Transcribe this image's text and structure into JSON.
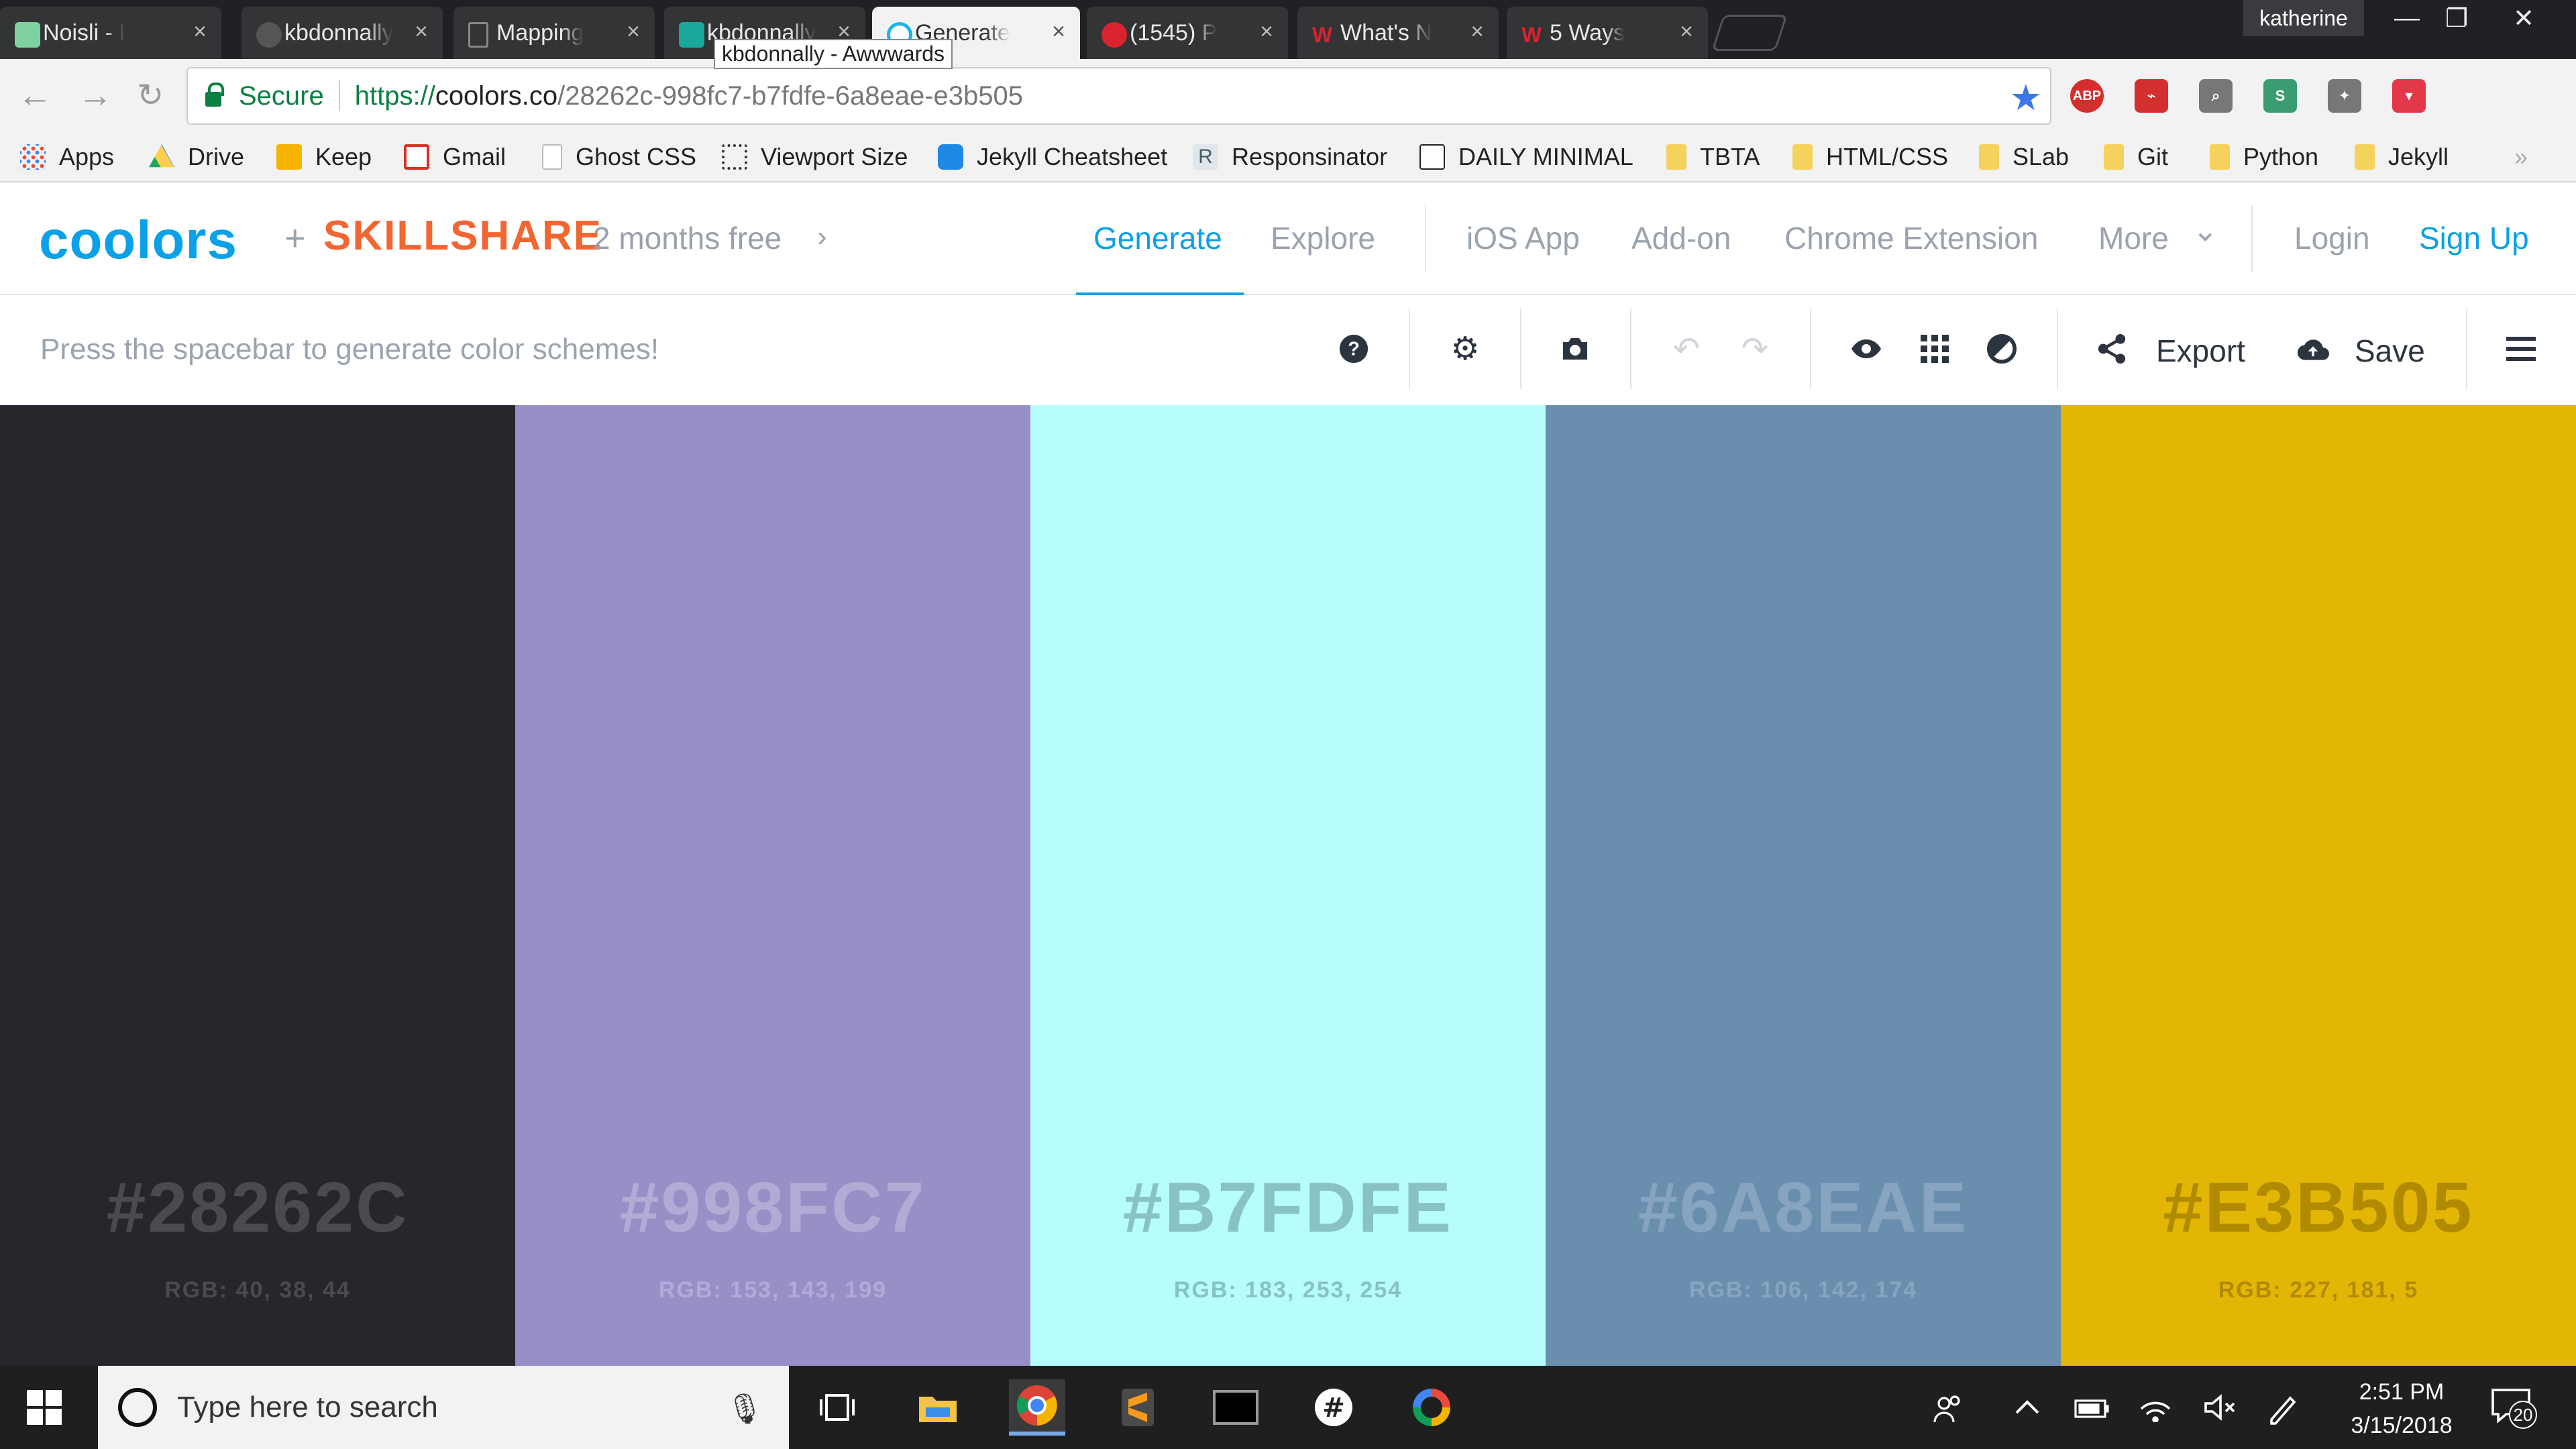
{
  "browser": {
    "tabs": [
      {
        "title": "Noisli - I",
        "favicon_color": "#7fd1a0"
      },
      {
        "title": "kbdonnally",
        "favicon_color": "#555555"
      },
      {
        "title": "Mapping",
        "favicon_color": "#777777"
      },
      {
        "title": "kbdonnally",
        "favicon_color": "#1aa89b"
      },
      {
        "title": "Generate",
        "favicon_color": "#1ab3ea",
        "active": true
      },
      {
        "title": "(1545) P",
        "favicon_color": "#d9232e"
      },
      {
        "title": "What's N",
        "favicon_color": "#d9232e"
      },
      {
        "title": "5 Ways",
        "favicon_color": "#d9232e"
      }
    ],
    "tab_close": "×",
    "tooltip": "kbdonnally - Awwwards",
    "profile": "katherine",
    "window_controls": {
      "minimize": "—",
      "restore": "❐",
      "close": "✕"
    },
    "address": {
      "secure_label": "Secure",
      "url_protocol": "https://",
      "url_host": "coolors.co",
      "url_path": "/28262c-998fc7-b7fdfe-6a8eae-e3b505"
    },
    "extensions": [
      {
        "name": "abp",
        "label": "ABP",
        "color": "#d32f2f"
      },
      {
        "name": "pdf",
        "label": "⌁",
        "color": "#d32f2f"
      },
      {
        "name": "inspect",
        "label": "⌕",
        "color": "#777777"
      },
      {
        "name": "s-ext",
        "label": "S",
        "color": "#3a9d72"
      },
      {
        "name": "bulb",
        "label": "✦",
        "color": "#777777"
      },
      {
        "name": "pocket",
        "label": "▾",
        "color": "#e2384a"
      }
    ],
    "bookmarks": [
      {
        "label": "Apps",
        "icon": "apps-grid-icon",
        "color": "#e84b3c"
      },
      {
        "label": "Drive",
        "icon": "drive-icon",
        "color": "#1fa463"
      },
      {
        "label": "Keep",
        "icon": "keep-icon",
        "color": "#f6b400"
      },
      {
        "label": "Gmail",
        "icon": "gmail-icon",
        "color": "#d93025"
      },
      {
        "label": "Ghost CSS",
        "icon": "page-icon",
        "color": "#dddddd"
      },
      {
        "label": "Viewport Size",
        "icon": "viewport-icon",
        "color": "#333333"
      },
      {
        "label": "Jekyll Cheatsheet",
        "icon": "eye-icon",
        "color": "#1e88e5"
      },
      {
        "label": "Responsinator",
        "icon": "r-icon",
        "color": "#607d8b"
      },
      {
        "label": "DAILY MINIMAL",
        "icon": "triangle-icon",
        "color": "#222222"
      },
      {
        "label": "TBTA",
        "icon": "folder-icon",
        "color": "#f5d25b"
      },
      {
        "label": "HTML/CSS",
        "icon": "folder-icon",
        "color": "#f5d25b"
      },
      {
        "label": "SLab",
        "icon": "folder-icon",
        "color": "#f5d25b"
      },
      {
        "label": "Git",
        "icon": "folder-icon",
        "color": "#f5d25b"
      },
      {
        "label": "Python",
        "icon": "folder-icon",
        "color": "#f5d25b"
      },
      {
        "label": "Jekyll",
        "icon": "folder-icon",
        "color": "#f5d25b"
      }
    ],
    "bookmarks_overflow": "»"
  },
  "site": {
    "logo": "coolors",
    "plus": "+",
    "partner": "SKILLSHARE",
    "promo": "2 months free",
    "promo_chevron": "›",
    "nav": {
      "generate": "Generate",
      "explore": "Explore",
      "ios_app": "iOS App",
      "addon": "Add-on",
      "chrome_extension": "Chrome Extension",
      "more": "More",
      "more_chevron": "⌄",
      "login": "Login",
      "signup": "Sign Up"
    },
    "toolbar": {
      "hint": "Press the spacebar to generate color schemes!",
      "export": "Export",
      "save": "Save"
    },
    "accent": "#0aa1e6"
  },
  "palette": [
    {
      "hex": "#28262C",
      "rgb": "RGB: 40, 38, 44",
      "bg": "#28262c",
      "text_color": "#4c4a51"
    },
    {
      "hex": "#998FC7",
      "rgb": "RGB: 153, 143, 199",
      "bg": "#998fc7",
      "text_color": "#b3abd6"
    },
    {
      "hex": "#B7FDFE",
      "rgb": "RGB: 183, 253, 254",
      "bg": "#b7fdfe",
      "text_color": "#88c2c4"
    },
    {
      "hex": "#6A8EAE",
      "rgb": "RGB: 106, 142, 174",
      "bg": "#6a8eae",
      "text_color": "#87a5c0"
    },
    {
      "hex": "#E3B505",
      "rgb": "RGB: 227, 181, 5",
      "bg": "#e3b505",
      "text_color": "#b08b00"
    }
  ],
  "taskbar": {
    "search_placeholder": "Type here to search",
    "time": "2:51 PM",
    "date": "3/15/2018",
    "notification_count": "20"
  }
}
